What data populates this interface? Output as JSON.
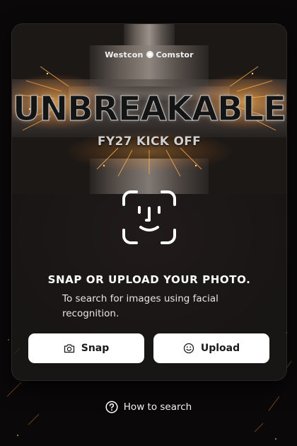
{
  "hero": {
    "brand_left": "Westcon",
    "brand_right": "Comstor",
    "headline": "UNBREAKABLE",
    "subheadline": "FY27 KICK OFF"
  },
  "main": {
    "title": "SNAP OR UPLOAD YOUR PHOTO.",
    "description": "To search for images using facial recognition.",
    "face_icon": "face-id-icon"
  },
  "actions": {
    "snap_label": "Snap",
    "snap_icon": "camera-icon",
    "upload_label": "Upload",
    "upload_icon": "smiley-icon"
  },
  "footer": {
    "help_label": "How to search",
    "help_icon": "question-circle-icon"
  },
  "colors": {
    "background": "#0d0b0a",
    "card": "#1e1b1a",
    "button": "#ffffff",
    "spark": "#ff9a3c"
  }
}
